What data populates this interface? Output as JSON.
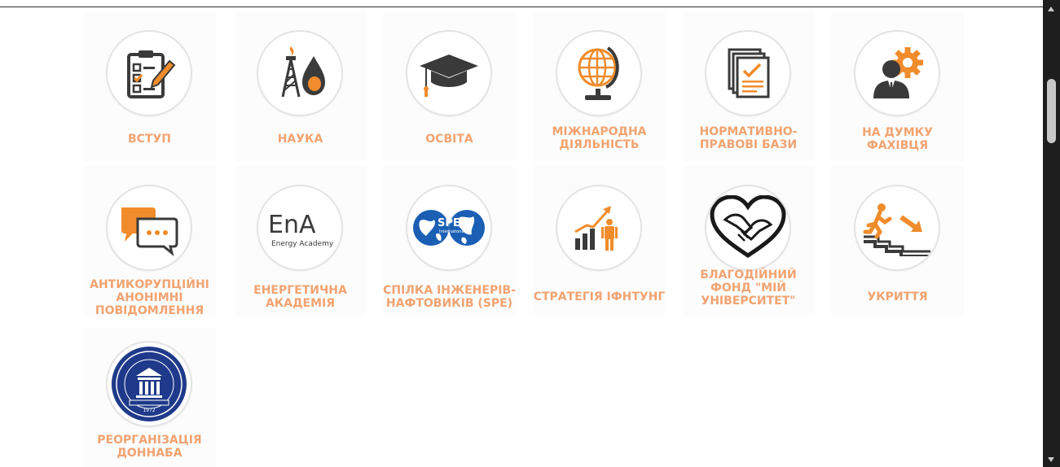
{
  "colors": {
    "label": "#f2a371",
    "accent_orange": "#f08c2c",
    "icon_dark": "#3a3a3a",
    "navy_seal": "#1f3a8a"
  },
  "tiles": [
    {
      "label": "ВСТУП",
      "icon": "clipboard-checklist-icon"
    },
    {
      "label": "НАУКА",
      "icon": "oil-derrick-drop-icon"
    },
    {
      "label": "ОСВІТА",
      "icon": "graduation-cap-icon"
    },
    {
      "label": "МІЖНАРОДНА ДІЯЛЬНІСТЬ",
      "icon": "globe-icon"
    },
    {
      "label": "НОРМАТИВНО-ПРАВОВІ БАЗИ",
      "icon": "documents-check-icon"
    },
    {
      "label": "НА ДУМКУ ФАХІВЦЯ",
      "icon": "expert-gear-icon"
    },
    {
      "label": "АНТИКОРУПЦІЙНІ АНОНІМНІ ПОВІДОМЛЕННЯ",
      "icon": "chat-bubbles-icon"
    },
    {
      "label": "ЕНЕРГЕТИЧНА АКАДЕМІЯ",
      "icon": "energy-academy-logo"
    },
    {
      "label": "СПІЛКА ІНЖЕНЕРІВ-НАФТОВИКІВ (SPE)",
      "icon": "spe-international-logo"
    },
    {
      "label": "СТРАТЕГІЯ ІФНТУНГ",
      "icon": "growth-chart-person-icon"
    },
    {
      "label": "БЛАГОДІЙНИЙ ФОНД \"МІЙ УНІВЕРСИТЕТ\"",
      "icon": "heart-hands-icon"
    },
    {
      "label": "УКРИТТЯ",
      "icon": "running-stairs-icon"
    },
    {
      "label": "РЕОРГАНІЗАЦІЯ ДОННАБА",
      "icon": "donnaba-seal-icon"
    }
  ],
  "logos": {
    "energy_academy_mark": "EnA",
    "energy_academy_caption": "Energy Academy",
    "spe_mark": "SPE",
    "spe_caption": "International",
    "seal_year": "1972"
  }
}
